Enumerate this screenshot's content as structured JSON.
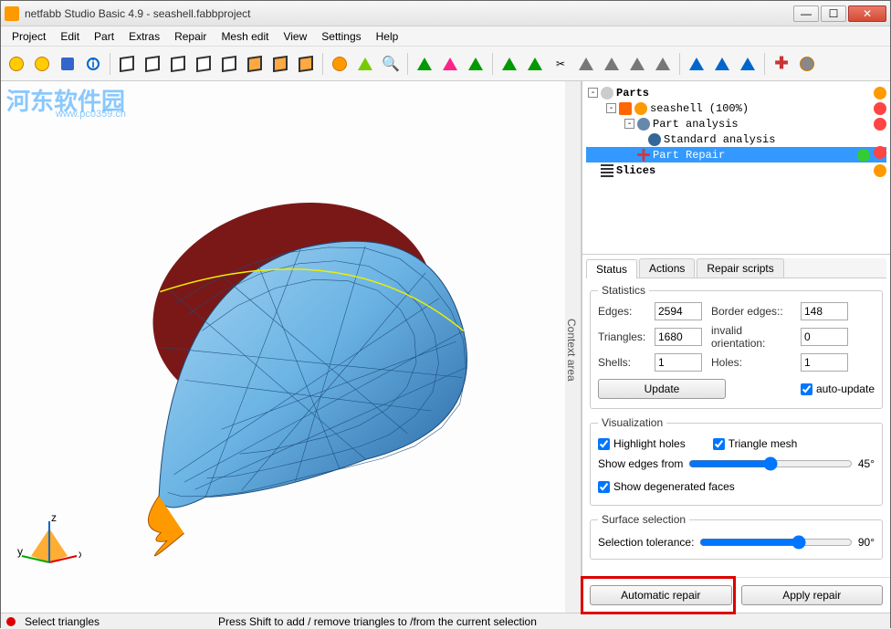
{
  "window": {
    "title": "netfabb Studio Basic 4.9 - seashell.fabbproject"
  },
  "menu": [
    "Project",
    "Edit",
    "Part",
    "Extras",
    "Repair",
    "Mesh edit",
    "View",
    "Settings",
    "Help"
  ],
  "watermark": {
    "text": "河东软件园",
    "url": "www.pc0359.cn"
  },
  "context_label": "Context area",
  "tree": {
    "parts_label": "Parts",
    "seashell_label": "seashell (100%)",
    "analysis_label": "Part analysis",
    "standard_label": "Standard analysis",
    "repair_label": "Part Repair",
    "slices_label": "Slices"
  },
  "tabs": {
    "status": "Status",
    "actions": "Actions",
    "scripts": "Repair scripts"
  },
  "stats": {
    "legend": "Statistics",
    "edges_label": "Edges:",
    "edges": "2594",
    "border_label": "Border edges::",
    "border": "148",
    "tri_label": "Triangles:",
    "tri": "1680",
    "inv_label": "invalid orientation:",
    "inv": "0",
    "shells_label": "Shells:",
    "shells": "1",
    "holes_label": "Holes:",
    "holes": "1",
    "update_btn": "Update",
    "auto_update": "auto-update"
  },
  "viz": {
    "legend": "Visualization",
    "highlight_holes": "Highlight holes",
    "tri_mesh": "Triangle mesh",
    "show_edges_label": "Show edges from",
    "show_edges_val": "45°",
    "degen": "Show degenerated faces"
  },
  "surf": {
    "legend": "Surface selection",
    "tol_label": "Selection tolerance:",
    "tol_val": "90°"
  },
  "bottom": {
    "auto": "Automatic repair",
    "apply": "Apply repair"
  },
  "status": {
    "mode": "Select triangles",
    "hint": "Press Shift to add / remove triangles to /from the current selection"
  },
  "axes": {
    "x": "x",
    "y": "y",
    "z": "z"
  }
}
